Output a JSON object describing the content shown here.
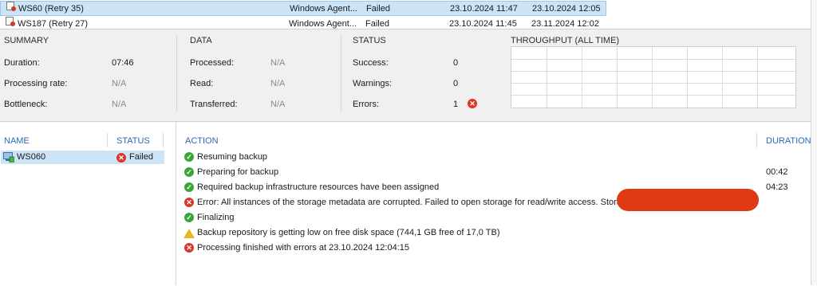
{
  "jobs": [
    {
      "name": "WS60 (Retry 35)",
      "type": "Windows Agent...",
      "status": "Failed",
      "start": "23.10.2024 11:47",
      "end": "23.10.2024 12:05",
      "selected": true
    },
    {
      "name": "WS187 (Retry 27)",
      "type": "Windows Agent...",
      "status": "Failed",
      "start": "23.10.2024 11:45",
      "end": "23.11.2024 12:02",
      "selected": false
    }
  ],
  "summary": {
    "heading": "SUMMARY",
    "rows": [
      {
        "label": "Duration:",
        "value": "07:46"
      },
      {
        "label": "Processing rate:",
        "value": "N/A"
      },
      {
        "label": "Bottleneck:",
        "value": "N/A"
      }
    ]
  },
  "data_section": {
    "heading": "DATA",
    "rows": [
      {
        "label": "Processed:",
        "value": "N/A"
      },
      {
        "label": "Read:",
        "value": "N/A"
      },
      {
        "label": "Transferred:",
        "value": "N/A"
      }
    ]
  },
  "status_section": {
    "heading": "STATUS",
    "rows": [
      {
        "label": "Success:",
        "value": "0"
      },
      {
        "label": "Warnings:",
        "value": "0"
      },
      {
        "label": "Errors:",
        "value": "1"
      }
    ]
  },
  "throughput": {
    "heading": "THROUGHPUT (ALL TIME)"
  },
  "objects": {
    "col_name": "NAME",
    "col_status": "STATUS",
    "rows": [
      {
        "name": "WS060",
        "status": "Failed"
      }
    ]
  },
  "actions": {
    "col_action": "ACTION",
    "col_duration": "DURATION",
    "rows": [
      {
        "icon": "success-icon",
        "text": "Resuming backup",
        "duration": ""
      },
      {
        "icon": "success-icon",
        "text": "Preparing for backup",
        "duration": "00:42"
      },
      {
        "icon": "success-icon",
        "text": "Required backup infrastructure resources have been assigned",
        "duration": "04:23"
      },
      {
        "icon": "error-icon",
        "text": "Error: All instances of the storage metadata are corrupted. Failed to open storage for read/write access. Storage:",
        "duration": ""
      },
      {
        "icon": "success-icon",
        "text": "Finalizing",
        "duration": ""
      },
      {
        "icon": "warning-icon",
        "text": "Backup repository is getting low on free disk space (744,1 GB free of 17,0 TB)",
        "duration": ""
      },
      {
        "icon": "error-icon",
        "text": "Processing finished with errors at 23.10.2024 12:04:15",
        "duration": ""
      }
    ]
  },
  "colors": {
    "accent": "#2a6ab5",
    "selection": "#cde4f7",
    "error": "#d9352a",
    "success": "#3aa63a",
    "warning": "#e8b820",
    "redaction": "#e03a12"
  }
}
